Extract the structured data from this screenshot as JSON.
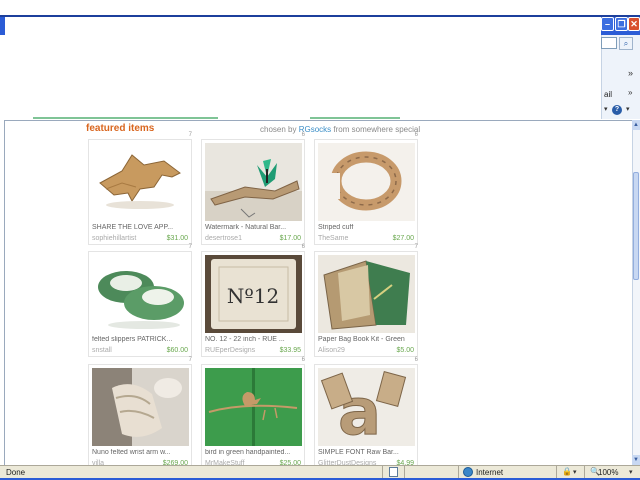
{
  "window": {
    "min_glyph": "–",
    "max_glyph": "❐",
    "close_glyph": "✕"
  },
  "toolbar": {
    "search_glyph": "⌕",
    "more_glyph": "»",
    "tab_fragment": "ail",
    "tab_arrow": "»",
    "help_glyph": "?",
    "dropdown_glyph": "▾"
  },
  "featured": {
    "title": "featured items",
    "chosen_prefix": "chosen by",
    "curator": "RGsocks",
    "chosen_suffix": "from",
    "source": "somewhere special"
  },
  "items": [
    {
      "title": "SHARE THE LOVE APP...",
      "seller": "sophiehillartist",
      "price": "$31.00",
      "num": "7"
    },
    {
      "title": "Watermark - Natural Bar...",
      "seller": "desertrose1",
      "price": "$17.00",
      "num": "6"
    },
    {
      "title": "Striped cuff",
      "seller": "TheSame",
      "price": "$27.00",
      "num": "6"
    },
    {
      "title": "felted slippers PATRICK...",
      "seller": "snstall",
      "price": "$60.00",
      "num": "7"
    },
    {
      "title": "NO. 12 - 22 inch  - RUE ...",
      "seller": "RUEperDesigns",
      "price": "$33.95",
      "num": "6"
    },
    {
      "title": "Paper Bag Book Kit - Green",
      "seller": "Alison29",
      "price": "$5.00",
      "num": "7"
    },
    {
      "title": "Nuno felted wrist arm w...",
      "seller": "villa",
      "price": "$269.00",
      "num": "7"
    },
    {
      "title": "bird in green handpainted...",
      "seller": "MrMakeStuff",
      "price": "$25.00",
      "num": "6"
    },
    {
      "title": "SIMPLE FONT Raw Bar...",
      "seller": "GlitterDustDesigns",
      "price": "$4.99",
      "num": "6"
    }
  ],
  "scroll": {
    "up_glyph": "▲",
    "down_glyph": "▼"
  },
  "status": {
    "text": "Done",
    "zone": "Internet",
    "zoom": "100%",
    "security_glyph": "🔒",
    "zoom_glyph": "🔍",
    "dropdown_glyph": "▾"
  },
  "colors": {
    "title_bar": "#2b5cd6",
    "featured_title": "#d9661f",
    "link": "#3b8ec7",
    "price": "#6aa84f"
  }
}
